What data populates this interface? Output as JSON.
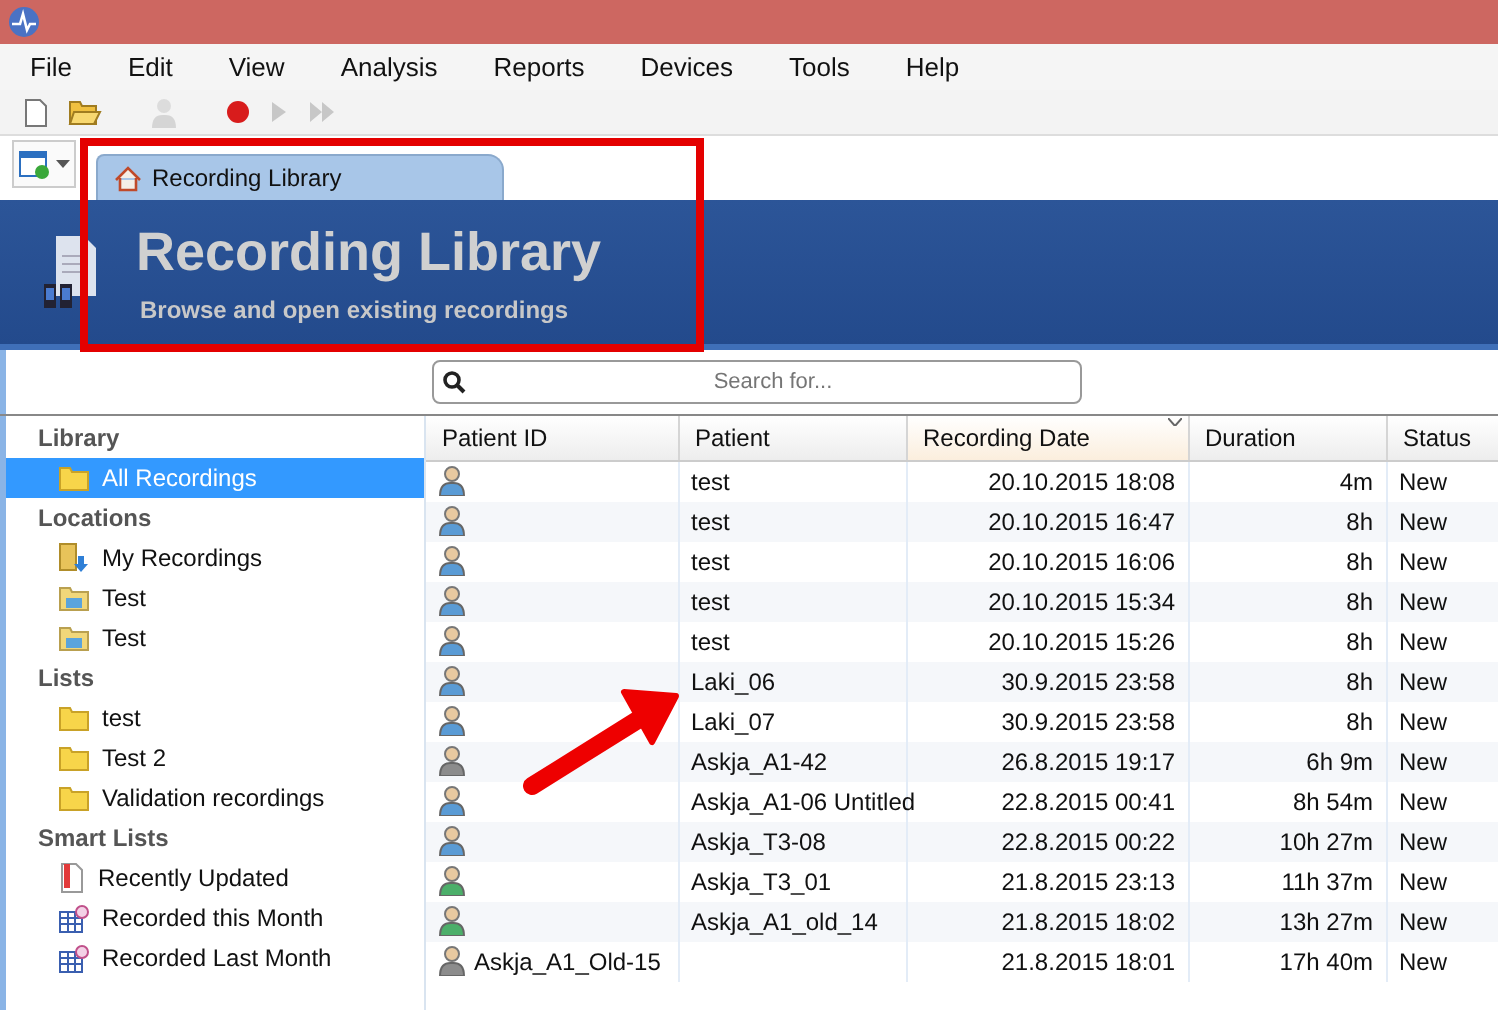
{
  "menu": [
    "File",
    "Edit",
    "View",
    "Analysis",
    "Reports",
    "Devices",
    "Tools",
    "Help"
  ],
  "toolbar": [
    {
      "kind": "new",
      "disabled": false
    },
    {
      "kind": "open",
      "disabled": false
    },
    {
      "kind": "person",
      "disabled": true
    },
    {
      "kind": "record",
      "disabled": false
    },
    {
      "kind": "play",
      "disabled": true
    },
    {
      "kind": "forward",
      "disabled": true
    }
  ],
  "tabs": [
    {
      "label": "Recording Library",
      "selected": true
    }
  ],
  "banner": {
    "title": "Recording Library",
    "subtitle": "Browse and open existing recordings"
  },
  "search": {
    "placeholder": "Search for..."
  },
  "sidebar": [
    {
      "kind": "group",
      "label": "Library"
    },
    {
      "kind": "folder",
      "label": "All Recordings",
      "selected": true
    },
    {
      "kind": "group",
      "label": "Locations"
    },
    {
      "kind": "download-folder",
      "label": "My Recordings",
      "selected": false
    },
    {
      "kind": "network-folder",
      "label": "Test",
      "selected": false
    },
    {
      "kind": "network-folder",
      "label": "Test",
      "selected": false
    },
    {
      "kind": "group",
      "label": "Lists"
    },
    {
      "kind": "folder",
      "label": "test",
      "selected": false
    },
    {
      "kind": "folder",
      "label": "Test 2",
      "selected": false
    },
    {
      "kind": "folder",
      "label": "Validation recordings",
      "selected": false
    },
    {
      "kind": "group",
      "label": "Smart Lists"
    },
    {
      "kind": "document",
      "label": "Recently Updated",
      "selected": false
    },
    {
      "kind": "calendar",
      "label": "Recorded this Month",
      "selected": false
    },
    {
      "kind": "calendar",
      "label": "Recorded Last Month",
      "selected": false
    }
  ],
  "table": {
    "columns": [
      {
        "label": "Patient ID",
        "sorted": false
      },
      {
        "label": "Patient",
        "sorted": false
      },
      {
        "label": "Recording Date",
        "sorted": true
      },
      {
        "label": "Duration",
        "sorted": false
      },
      {
        "label": "Status",
        "sorted": false
      }
    ],
    "rows": [
      {
        "color": "#5a9bd5",
        "patient_id": "",
        "patient": "test",
        "date": "20.10.2015 18:08",
        "duration": "4m",
        "status": "New"
      },
      {
        "color": "#5a9bd5",
        "patient_id": "",
        "patient": "test",
        "date": "20.10.2015 16:47",
        "duration": "8h",
        "status": "New"
      },
      {
        "color": "#5a9bd5",
        "patient_id": "",
        "patient": "test",
        "date": "20.10.2015 16:06",
        "duration": "8h",
        "status": "New"
      },
      {
        "color": "#5a9bd5",
        "patient_id": "",
        "patient": "test",
        "date": "20.10.2015 15:34",
        "duration": "8h",
        "status": "New"
      },
      {
        "color": "#5a9bd5",
        "patient_id": "",
        "patient": "test",
        "date": "20.10.2015 15:26",
        "duration": "8h",
        "status": "New"
      },
      {
        "color": "#5a9bd5",
        "patient_id": "",
        "patient": "Laki_06",
        "date": "30.9.2015 23:58",
        "duration": "8h",
        "status": "New"
      },
      {
        "color": "#5a9bd5",
        "patient_id": "",
        "patient": "Laki_07",
        "date": "30.9.2015 23:58",
        "duration": "8h",
        "status": "New"
      },
      {
        "color": "#8c8c8c",
        "patient_id": "",
        "patient": "Askja_A1-42",
        "date": "26.8.2015 19:17",
        "duration": "6h 9m",
        "status": "New"
      },
      {
        "color": "#5a9bd5",
        "patient_id": "",
        "patient": "Askja_A1-06 Untitled",
        "date": "22.8.2015 00:41",
        "duration": "8h 54m",
        "status": "New"
      },
      {
        "color": "#5a9bd5",
        "patient_id": "",
        "patient": "Askja_T3-08",
        "date": "22.8.2015 00:22",
        "duration": "10h 27m",
        "status": "New"
      },
      {
        "color": "#4caf6a",
        "patient_id": "",
        "patient": "Askja_T3_01",
        "date": "21.8.2015 23:13",
        "duration": "11h 37m",
        "status": "New"
      },
      {
        "color": "#4caf6a",
        "patient_id": "",
        "patient": "Askja_A1_old_14",
        "date": "21.8.2015 18:02",
        "duration": "13h 27m",
        "status": "New"
      },
      {
        "color": "#8c8c8c",
        "patient_id": "Askja_A1_Old-15",
        "patient": "",
        "date": "21.8.2015 18:01",
        "duration": "17h 40m",
        "status": "New"
      }
    ]
  },
  "annotations": {
    "highlight_frame": true,
    "pointer_arrow": true
  }
}
